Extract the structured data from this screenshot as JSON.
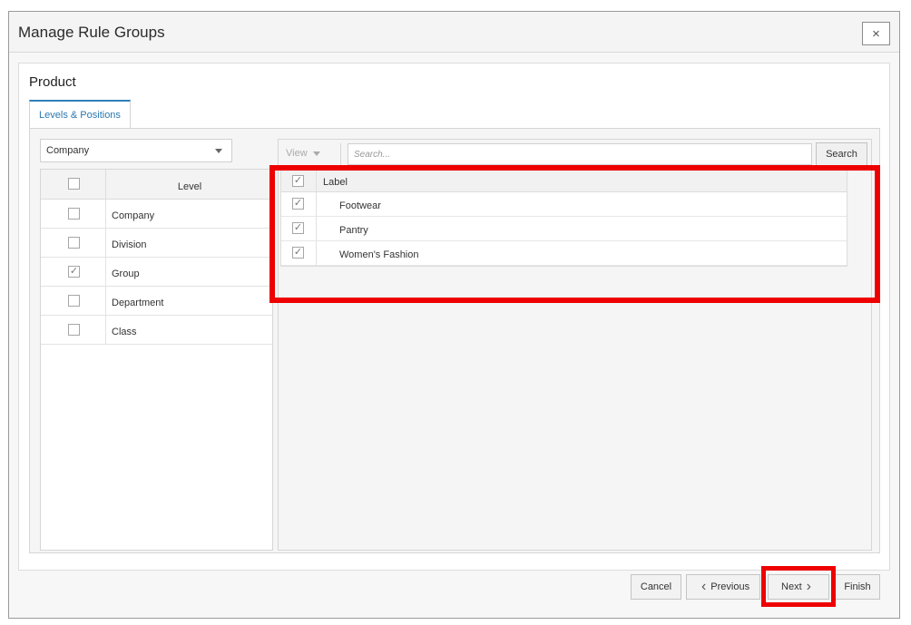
{
  "dialog": {
    "title": "Manage Rule Groups",
    "close_glyph": "×"
  },
  "section": {
    "title": "Product",
    "tab_label": "Levels & Positions"
  },
  "level_select": {
    "value": "Company"
  },
  "level_table": {
    "header": "Level",
    "rows": [
      {
        "label": "Company",
        "checked": false,
        "mark": ""
      },
      {
        "label": "Division",
        "checked": false,
        "mark": ""
      },
      {
        "label": "Group",
        "checked": true,
        "mark": "✓"
      },
      {
        "label": "Department",
        "checked": false,
        "mark": ""
      },
      {
        "label": "Class",
        "checked": false,
        "mark": ""
      }
    ]
  },
  "toolbar": {
    "view_label": "View",
    "search_placeholder": "Search...",
    "search_button": "Search"
  },
  "label_table": {
    "header": "Label",
    "header_mark": "✓",
    "rows": [
      {
        "label": "Footwear",
        "mark": "✓"
      },
      {
        "label": "Pantry",
        "mark": "✓"
      },
      {
        "label": "Women's Fashion",
        "mark": "✓"
      }
    ]
  },
  "footer": {
    "cancel": "Cancel",
    "previous": "Previous",
    "previous_glyph": "‹",
    "next": "Next",
    "next_glyph": "›",
    "finish": "Finish"
  },
  "colors": {
    "highlight": "#ee0000",
    "accent": "#2f7fb8"
  }
}
